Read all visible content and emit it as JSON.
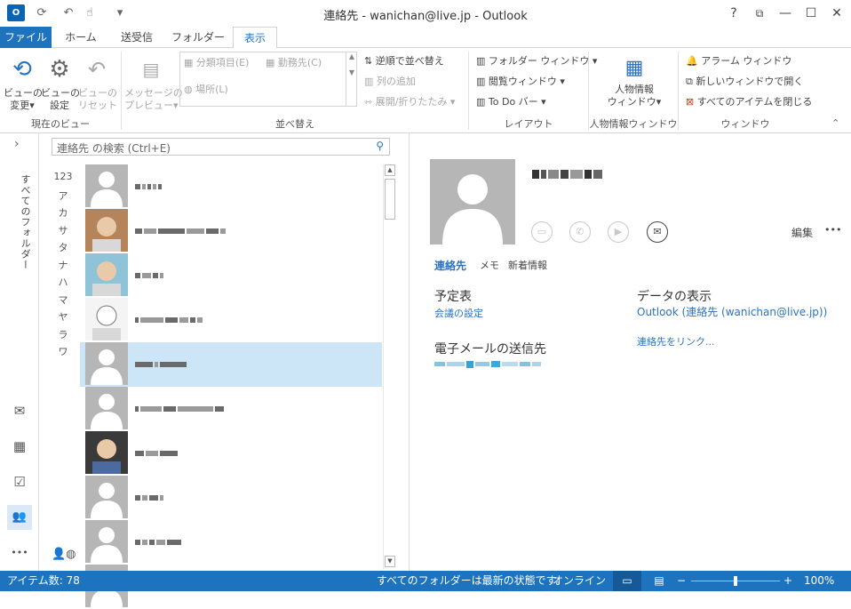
{
  "window": {
    "title": "連絡先 - wanichan@live.jp - Outlook",
    "help": "?",
    "app_icon": "O",
    "restore": "⧉",
    "minimize": "—",
    "maximize": "☐",
    "close": "✕"
  },
  "quick_access": {
    "sync": "⟳",
    "undo": "↶",
    "touch": "☝",
    "customize": "▾"
  },
  "tabs": [
    "ファイル",
    "ホーム",
    "送受信",
    "フォルダー",
    "表示"
  ],
  "ribbon": {
    "groups": {
      "current_view": "現在のビュー",
      "arrange": "並べ替え",
      "layout": "レイアウト",
      "people": "人物情報ウィンドウ",
      "window": "ウィンドウ"
    },
    "change_view": "ビューの\n変更▾",
    "view_settings": "ビューの\n設定",
    "reset_view": "ビューの\nリセット",
    "message_preview": "メッセージの\nプレビュー▾",
    "categories": "分類項目(E)",
    "company": "勤務先(C)",
    "location": "場所(L)",
    "reverse_sort": "逆順で並べ替え",
    "add_columns": "列の追加",
    "expand_collapse": "展開/折りたたみ ▾",
    "folder_pane": "フォルダー ウィンドウ ▾",
    "reading_pane": "閲覧ウィンドウ ▾",
    "todo_bar": "To Do バー ▾",
    "people_pane": "人物情報\nウィンドウ▾",
    "reminders": "アラーム ウィンドウ",
    "open_new_window": "新しいウィンドウで開く",
    "close_all": "すべてのアイテムを閉じる"
  },
  "nav": {
    "all_folders": "すべてのフォルダー",
    "expand": "›",
    "mail": "✉",
    "calendar": "▦",
    "tasks": "☑",
    "people": "👥",
    "more": "•••"
  },
  "search": {
    "placeholder": "連絡先 の検索 (Ctrl+E)"
  },
  "alpha": [
    "123",
    "ア",
    "カ",
    "サ",
    "タ",
    "ナ",
    "ハ",
    "マ",
    "ヤ",
    "ラ",
    "ワ"
  ],
  "contacts_count": 10,
  "detail": {
    "edit": "編集",
    "more": "•••",
    "tabs": [
      "連絡先",
      "メモ",
      "新着情報"
    ],
    "schedule_title": "予定表",
    "schedule_link": "会議の設定",
    "data_title": "データの表示",
    "data_link": "Outlook (連絡先 (wanichan@live.jp))",
    "email_title": "電子メールの送信先",
    "link_contacts": "連絡先をリンク..."
  },
  "status": {
    "items": "アイテム数: 78",
    "sync": "すべてのフォルダーは最新の状態です。",
    "online": "オンライン",
    "zoom": "100%"
  },
  "colors": {
    "accent": "#1e73be",
    "link": "#2b72c2",
    "selected_row": "#cde6f7"
  }
}
